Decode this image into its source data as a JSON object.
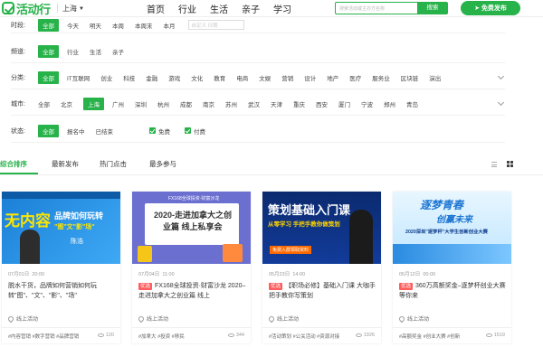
{
  "brand": {
    "name": "活动行",
    "accent": "#27b24a"
  },
  "city": {
    "name": "上海"
  },
  "nav": [
    "首页",
    "行业",
    "生活",
    "亲子",
    "学习"
  ],
  "search": {
    "placeholder": "搜索活动或主办方名称",
    "button": "搜索"
  },
  "publish": {
    "label": "免费发布"
  },
  "filters": {
    "time": {
      "label": "时段:",
      "options": [
        "全部",
        "今天",
        "明天",
        "本周",
        "本周末",
        "本月"
      ],
      "date_placeholder": "自定义 日期"
    },
    "channel": {
      "label": "频道:",
      "options": [
        "全部",
        "行业",
        "生活",
        "亲子"
      ]
    },
    "category": {
      "label": "分类:",
      "options": [
        "全部",
        "IT互联网",
        "创业",
        "科技",
        "金融",
        "游戏",
        "文化",
        "教育",
        "电商",
        "文娱",
        "营销",
        "设计",
        "地产",
        "医疗",
        "服务业",
        "区块链",
        "演出"
      ]
    },
    "city": {
      "label": "城市:",
      "options": [
        "全部",
        "北京",
        "上海",
        "广州",
        "深圳",
        "杭州",
        "成都",
        "南京",
        "苏州",
        "武汉",
        "天津",
        "重庆",
        "西安",
        "厦门",
        "宁波",
        "郑州",
        "青岛"
      ]
    },
    "status": {
      "label": "状态:",
      "options": [
        "全部",
        "报名中",
        "已结束"
      ],
      "checks": [
        "免费",
        "付费"
      ]
    }
  },
  "sort_tabs": [
    "综合排序",
    "最新发布",
    "热门点击",
    "最多参与"
  ],
  "cards": [
    {
      "date": "07月01日",
      "time": "20:00",
      "title": "脱水干货，品牌如何营销如何玩转\"图\"、\"文\"、\"影\"、\"场\"",
      "hot": false,
      "org": "线上活动",
      "tags": "#内容营销 #数字营销 #品牌营销",
      "views": "120",
      "banner": {
        "line1": "无内容",
        "line2": "品牌如何玩转",
        "line3": "\"图\"文\"影\"场\"",
        "speaker": "陈浩"
      }
    },
    {
      "date": "07月04日",
      "time": "11:00",
      "title": "FX168全球投资·财富沙龙 2020–走进加拿大之创业篇 线上",
      "hot": true,
      "hot_label": "优选",
      "org": "线上活动",
      "tags": "#加拿大 #投资 #移民",
      "views": "344",
      "banner": {
        "top": "FX168全球投资·财富沙龙",
        "line1": "2020-走进加拿大之创",
        "line2": "业篇 线上私享会"
      }
    },
    {
      "date": "05月23日",
      "time": "14:00",
      "title": "【职场必修】基础入门课 大咖手把手教你写策划",
      "hot": true,
      "hot_label": "优选",
      "org": "线上活动",
      "tags": "#活动策划 #公关活动 #资源对接",
      "views": "1926",
      "banner": {
        "line1": "策划基础入门课",
        "line2": "从零学习 手把手教你做策划",
        "badge": "免费入群领取资料"
      }
    },
    {
      "date": "05月12日",
      "time": "00:00",
      "title": "360万高额奖金–逐梦杯创业大赛等你来",
      "hot": true,
      "hot_label": "优选",
      "org": "线上活动",
      "tags": "#高额奖金 #创业大赛 #创新",
      "views": "1519",
      "banner": {
        "line1": "逐梦青春",
        "line2": "创赢未来",
        "line3": "2020深圳\"逐梦杯\"大学生创新创业大赛"
      }
    }
  ]
}
